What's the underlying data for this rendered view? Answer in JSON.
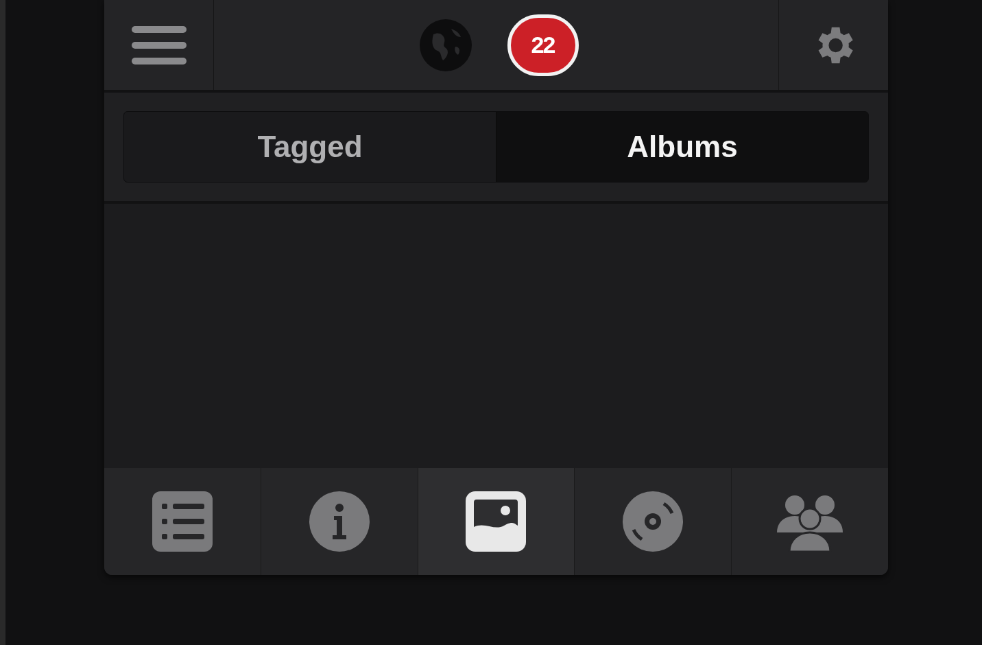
{
  "top_bar": {
    "badge": "22"
  },
  "segments": [
    {
      "label": "Tagged",
      "selected": false
    },
    {
      "label": "Albums",
      "selected": true
    }
  ],
  "tab_bar": [
    {
      "kind": "list",
      "selected": false
    },
    {
      "kind": "info",
      "selected": false
    },
    {
      "kind": "photo",
      "selected": true
    },
    {
      "kind": "disc",
      "selected": false
    },
    {
      "kind": "people",
      "selected": false
    }
  ]
}
